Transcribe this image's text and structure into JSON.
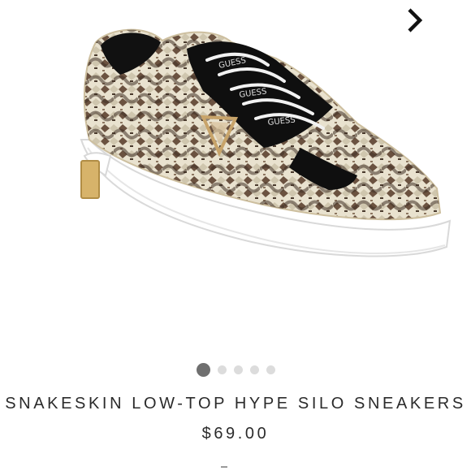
{
  "carousel": {
    "next_icon": "chevron-right-icon",
    "slides_count": 5,
    "active_index": 0
  },
  "product": {
    "title": "SNAKESKIN LOW-TOP HYPE SILO SNEAKERS",
    "price": "$69.00",
    "image": "snakeskin-sneaker-image"
  },
  "colors": {
    "text": "#2b2b2b",
    "dot_active": "#6f6f6f",
    "dot_inactive": "#dcdcdc"
  }
}
